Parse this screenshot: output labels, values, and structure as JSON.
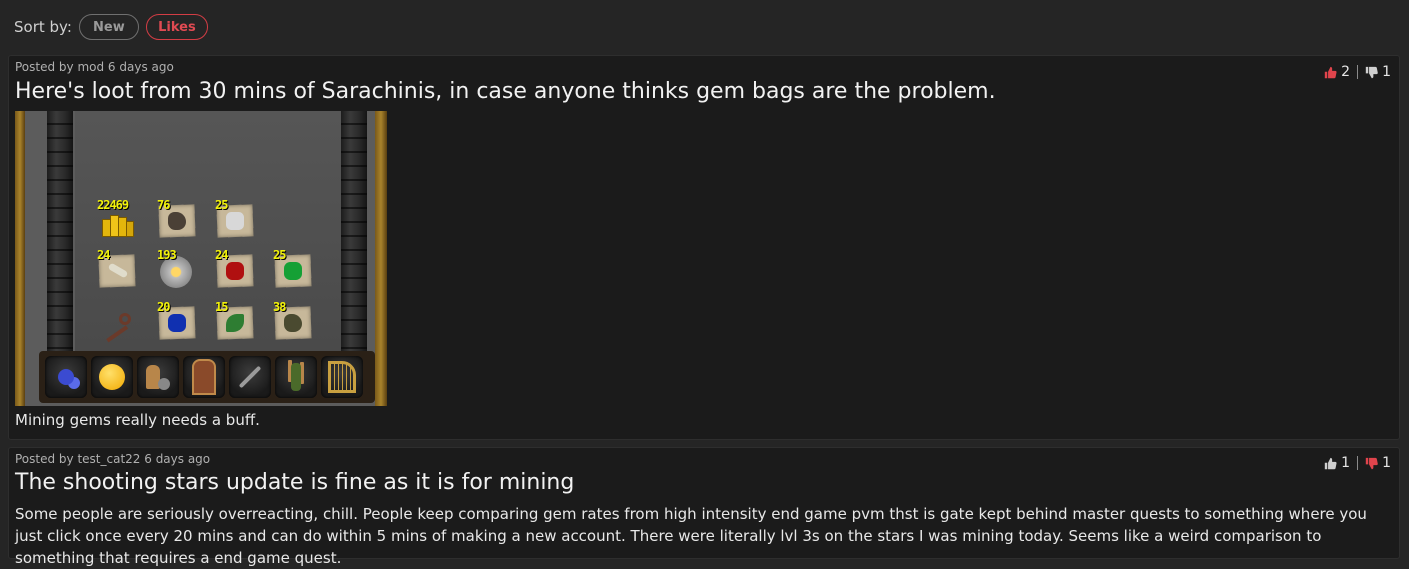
{
  "sort": {
    "label": "Sort by:",
    "options": [
      {
        "label": "New",
        "active": false
      },
      {
        "label": "Likes",
        "active": true
      }
    ],
    "active_color": "#e04a52"
  },
  "posts": [
    {
      "meta": "Posted by mod 6 days ago",
      "title": "Here's loot from 30 mins of Sarachinis, in case anyone thinks gem bags are the problem.",
      "body": "Mining gems really needs a buff.",
      "likes": "2",
      "dislikes": "1",
      "liked": true,
      "disliked": false,
      "image": {
        "inventory": [
          {
            "qty": "22469",
            "icon": "coins-icon"
          },
          {
            "qty": "76",
            "icon": "ore-icon"
          },
          {
            "qty": "25",
            "icon": "diamond-icon"
          },
          {
            "qty": "24",
            "icon": "bones-icon"
          },
          {
            "qty": "193",
            "icon": "rune-icon"
          },
          {
            "qty": "24",
            "icon": "ruby-icon"
          },
          {
            "qty": "25",
            "icon": "emerald-icon"
          },
          {
            "qty": "",
            "icon": "key-icon"
          },
          {
            "qty": "20",
            "icon": "sapphire-icon"
          },
          {
            "qty": "15",
            "icon": "herb-icon"
          },
          {
            "qty": "38",
            "icon": "ore-icon"
          }
        ],
        "tabs": [
          "prayer-tab-icon",
          "emote-tab-icon",
          "settings-tab-icon",
          "logout-door-icon",
          "wrench-icon",
          "character-icon",
          "harp-icon"
        ]
      }
    },
    {
      "meta": "Posted by test_cat22 6 days ago",
      "title": "The shooting stars update is fine as it is for mining",
      "body": "Some people are seriously overreacting, chill. People keep comparing gem rates from high intensity end game pvm thst is gate kept behind master quests to something where you just click once every 20 mins and can do within 5 mins of making a new account. There were literally lvl 3s on the stars I was mining today. Seems like a weird comparison to something that requires a end game quest.",
      "likes": "1",
      "dislikes": "1",
      "liked": false,
      "disliked": true
    }
  ],
  "colors": {
    "accent": "#d33d45",
    "background": "#252525",
    "card": "#1b1b1b"
  }
}
